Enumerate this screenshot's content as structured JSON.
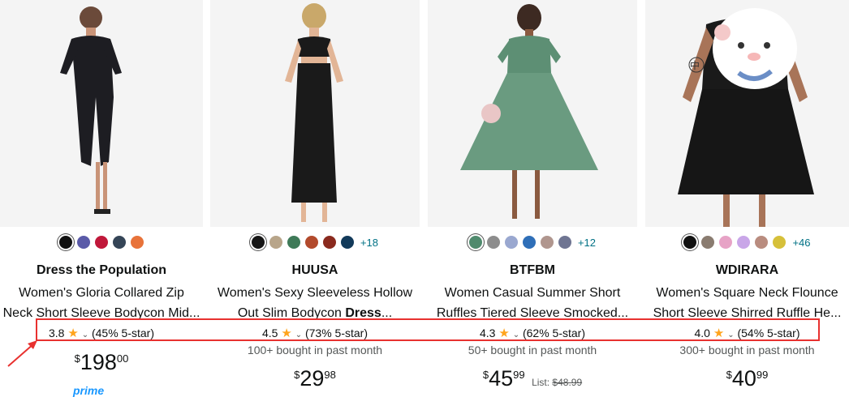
{
  "products": [
    {
      "brand": "Dress the Population",
      "title_line1": "Women's Gloria Collared Zip",
      "title_line2": "Neck Short Sleeve Bodycon Mid...",
      "rating": "3.8",
      "five_star": "(45% 5-star)",
      "bought": "",
      "price_symbol": "$",
      "price_whole": "198",
      "price_fraction": "00",
      "list_label": "",
      "list_price": "",
      "badge": "prime",
      "more_colors": "",
      "swatch_colors": [
        "#111111",
        "#5a5aa8",
        "#c0183a",
        "#354557",
        "#e8733a"
      ]
    },
    {
      "brand": "HUUSA",
      "title_line1": "Women's Sexy Sleeveless Hollow",
      "title_line2_prefix": "Out Slim Bodycon ",
      "title_line2_bold": "Dress",
      "title_line2_suffix": "...",
      "rating": "4.5",
      "five_star": "(73% 5-star)",
      "bought": "100+ bought in past month",
      "price_symbol": "$",
      "price_whole": "29",
      "price_fraction": "98",
      "list_label": "",
      "list_price": "",
      "more_colors": "+18",
      "swatch_colors": [
        "#151515",
        "#b8a58a",
        "#3f7a58",
        "#b24a2c",
        "#8a2a1e",
        "#123a5a"
      ]
    },
    {
      "brand": "BTFBM",
      "title_line1": "Women Casual Summer Short",
      "title_line2": "Ruffles Tiered Sleeve Smocked...",
      "rating": "4.3",
      "five_star": "(62% 5-star)",
      "bought": "50+ bought in past month",
      "price_symbol": "$",
      "price_whole": "45",
      "price_fraction": "99",
      "list_label": "List:",
      "list_price": "$48.99",
      "more_colors": "+12",
      "swatch_colors": [
        "#4f8a6d",
        "#8d8d8d",
        "#9aa8d0",
        "#2f6fb8",
        "#b0968e",
        "#6f7592"
      ]
    },
    {
      "brand": "WDIRARA",
      "title_line1": "Women's Square Neck Flounce",
      "title_line2": "Short Sleeve Shirred Ruffle He...",
      "rating": "4.0",
      "five_star": "(54% 5-star)",
      "bought": "300+ bought in past month",
      "price_symbol": "$",
      "price_whole": "40",
      "price_fraction": "99",
      "list_label": "",
      "list_price": "",
      "more_colors": "+46",
      "swatch_colors": [
        "#111111",
        "#8a7c70",
        "#e7a3c6",
        "#c9a6e8",
        "#b98c7f",
        "#d6c03a"
      ]
    }
  ],
  "overlay": {
    "kanji": "中",
    "highlight_color": "#e8312f"
  },
  "icons": {
    "star": "★",
    "chevron": "⌄"
  }
}
